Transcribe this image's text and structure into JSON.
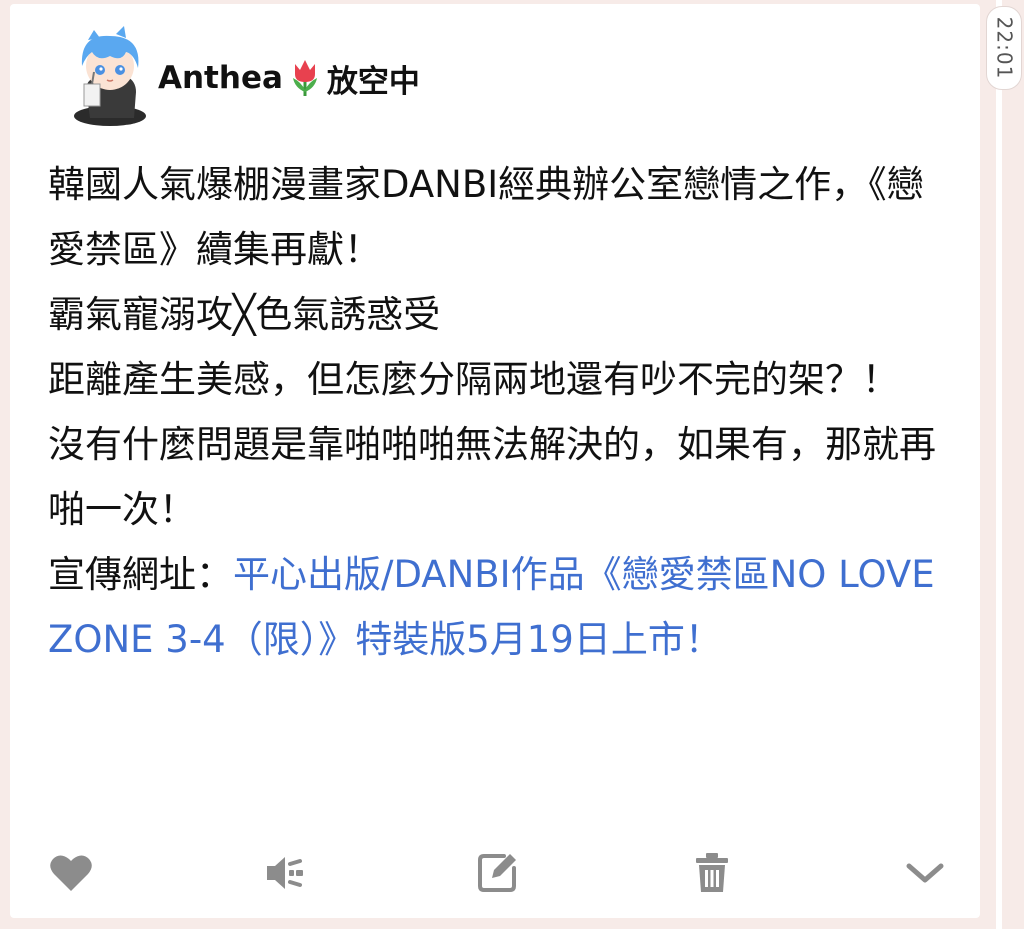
{
  "status_bar": {
    "time": "22:01"
  },
  "post": {
    "author": "Anthea",
    "status": "放空中",
    "lines": [
      "韓國人氣爆棚漫畫家DANBI經典辦公室戀情之作，《戀愛禁區》續集再獻！",
      "霸氣寵溺攻╳色氣誘惑受",
      "距離產生美感，但怎麼分隔兩地還有吵不完的架？！",
      "沒有什麼問題是靠啪啪啪無法解決的，如果有，那就再啪一次！"
    ],
    "promo_label": "宣傳網址：",
    "promo_link_text": "平心出版/DANBI作品《戀愛禁區NO LOVE ZONE 3-4（限）》特裝版5月19日上市！"
  },
  "actions": {
    "icons": [
      "heart-icon",
      "speaker-icon",
      "edit-icon",
      "trash-icon",
      "chevron-down-icon"
    ]
  },
  "colors": {
    "link": "#3f6fd0",
    "icon": "#8c8c8c",
    "background": "#f7ebe8",
    "card": "#ffffff"
  }
}
